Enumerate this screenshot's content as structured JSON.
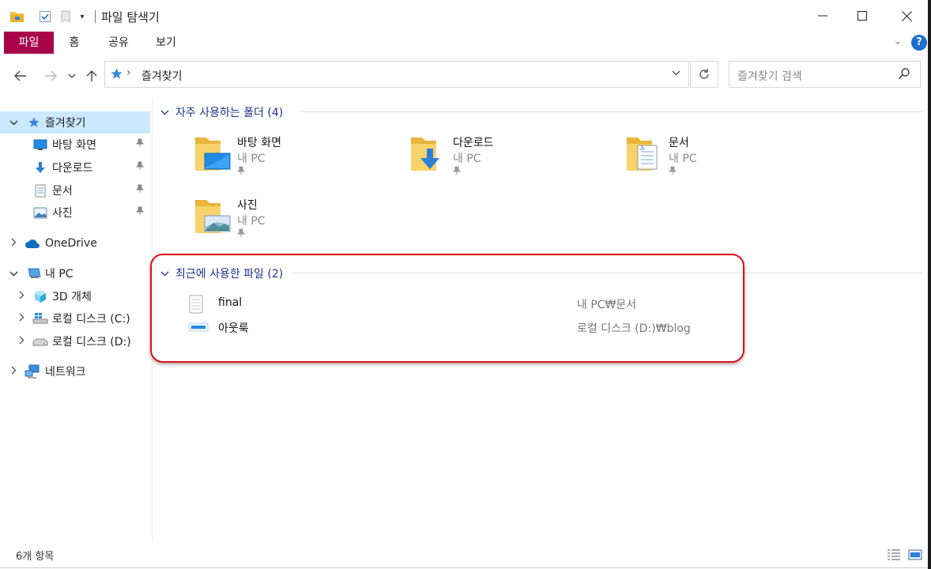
{
  "window": {
    "title": "파일 탐색기"
  },
  "ribbon": {
    "tabs": [
      {
        "label": "파일"
      },
      {
        "label": "홈"
      },
      {
        "label": "공유"
      },
      {
        "label": "보기"
      }
    ],
    "help_label": "?",
    "file_tab_color": "#a8034a"
  },
  "address": {
    "crumb": "즐겨찾기",
    "search_placeholder": "즐겨찾기 검색"
  },
  "sidebar": {
    "items": [
      {
        "label": "즐겨찾기",
        "icon": "star-icon"
      },
      {
        "label": "바탕 화면",
        "icon": "desktop-icon",
        "pinned": true
      },
      {
        "label": "다운로드",
        "icon": "download-icon",
        "pinned": true
      },
      {
        "label": "문서",
        "icon": "document-icon",
        "pinned": true
      },
      {
        "label": "사진",
        "icon": "picture-icon",
        "pinned": true
      },
      {
        "label": "OneDrive",
        "icon": "cloud-icon"
      },
      {
        "label": "내 PC",
        "icon": "pc-icon"
      },
      {
        "label": "3D 개체",
        "icon": "cube-icon"
      },
      {
        "label": "로컬 디스크 (C:)",
        "icon": "windows-drive-icon"
      },
      {
        "label": "로컬 디스크 (D:)",
        "icon": "drive-icon"
      },
      {
        "label": "네트워크",
        "icon": "network-icon"
      }
    ]
  },
  "frequent": {
    "header": "자주 사용하는 폴더 (4)",
    "folders": [
      {
        "name": "바탕 화면",
        "location": "내 PC",
        "icon": "desktop-folder-icon"
      },
      {
        "name": "다운로드",
        "location": "내 PC",
        "icon": "download-folder-icon"
      },
      {
        "name": "문서",
        "location": "내 PC",
        "icon": "documents-folder-icon"
      },
      {
        "name": "사진",
        "location": "내 PC",
        "icon": "pictures-folder-icon"
      }
    ]
  },
  "recent": {
    "header": "최근에 사용한 파일 (2)",
    "files": [
      {
        "name": "final",
        "path": "내 PC₩문서",
        "icon": "text-file-icon"
      },
      {
        "name": "아웃룩",
        "path": "로컬 디스크 (D:)₩blog",
        "icon": "image-file-icon"
      }
    ]
  },
  "status": {
    "count": "6개 항목"
  },
  "colors": {
    "selection": "#cce8ff",
    "group_header": "#1e3287",
    "highlight_border": "#e0101a"
  }
}
